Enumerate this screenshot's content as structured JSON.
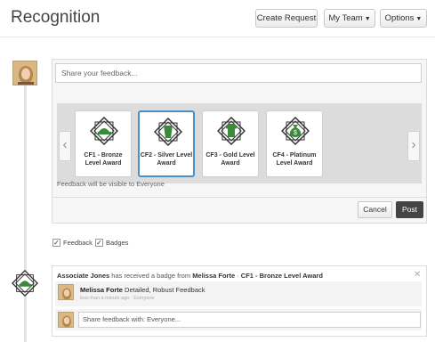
{
  "header": {
    "title": "Recognition",
    "create_request": "Create Request",
    "my_team": "My Team",
    "options": "Options"
  },
  "composer": {
    "placeholder": "Share your feedback...",
    "badges": [
      {
        "label": "CF1 - Bronze Level Award",
        "icon": "hat-badge-icon",
        "color": "#3a8a3a"
      },
      {
        "label": "CF2 - Silver Level Award",
        "icon": "cup-badge-icon",
        "color": "#3a8a3a"
      },
      {
        "label": "CF3 - Gold Level Award",
        "icon": "shirt-badge-icon",
        "color": "#3a8a3a"
      },
      {
        "label": "CF4 - Platinum Level Award",
        "icon": "money-bag-badge-icon",
        "color": "#3a8a3a"
      }
    ],
    "selected_badge": 1,
    "visibility_note": "Feedback will be visible to Everyone",
    "cancel": "Cancel",
    "post": "Post"
  },
  "filters": {
    "feedback": {
      "label": "Feedback",
      "checked": true
    },
    "badges": {
      "label": "Badges",
      "checked": true
    }
  },
  "feed": {
    "item": {
      "recipient": "Associate Jones",
      "text1": " has received a badge from ",
      "giver": "Melissa Forte",
      "sep": " · ",
      "badge": "CF1 - Bronze Level Award"
    },
    "comment": {
      "author": "Melissa Forte",
      "text": " Detailed, Robust Feedback",
      "time": "less than a minute ago · Everyone"
    },
    "share_placeholder": "Share feedback with: Everyone..."
  },
  "colors": {
    "accent": "#4a90c8",
    "post_button": "#444444",
    "badge_green": "#3a8a3a"
  }
}
